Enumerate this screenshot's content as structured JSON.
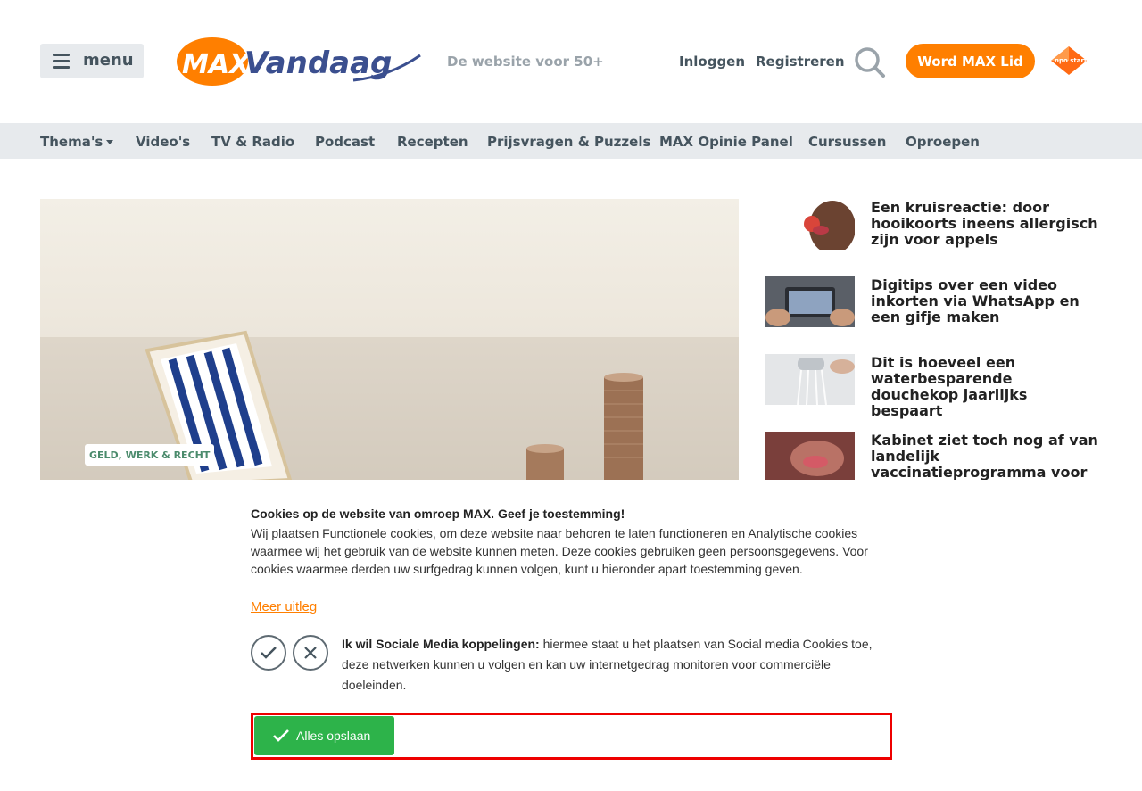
{
  "header": {
    "menu_label": "menu",
    "tagline": "De website voor 50+",
    "login": "Inloggen",
    "register": "Registreren",
    "member_button": "Word MAX Lid",
    "npo_label": "npo start"
  },
  "nav": {
    "items": [
      "Thema's",
      "Video's",
      "TV & Radio",
      "Podcast",
      "Recepten",
      "Prijsvragen & Puzzels",
      "MAX Opinie Panel",
      "Cursussen",
      "Oproepen"
    ]
  },
  "hero": {
    "badge": "GELD, WERK & RECHT"
  },
  "sidebar": {
    "items": [
      {
        "title": "Een kruisreactie: door hooikoorts ineens allergisch zijn voor appels"
      },
      {
        "title": "Digitips over een video inkorten via WhatsApp en een gifje maken"
      },
      {
        "title": "Dit is hoeveel een waterbesparende douchekop jaarlijks bespaart"
      },
      {
        "title": "Kabinet ziet toch nog af van landelijk vaccinatieprogramma voor"
      }
    ]
  },
  "cookie": {
    "title": "Cookies op de website van omroep MAX. Geef je toestemming!",
    "text": "Wij plaatsen Functionele cookies, om deze website naar behoren te laten functioneren en Analytische cookies waarmee wij het gebruik van de website kunnen meten. Deze cookies gebruiken geen persoonsgegevens. Voor cookies waarmee derden uw surfgedrag kunnen volgen, kunt u hieronder apart toestemming geven.",
    "more_link": "Meer uitleg",
    "social_bold": "Ik wil Sociale Media koppelingen:",
    "social_text": " hiermee staat u het plaatsen van Social media Cookies toe, deze netwerken kunnen u volgen en kan uw internetgedrag monitoren voor commerciële doeleinden.",
    "save_button": "Alles opslaan"
  },
  "colors": {
    "brand_orange": "#ff7f00",
    "brand_blue": "#3b4f8f",
    "nav_bg": "#e7eaed",
    "save_green": "#2db34a",
    "highlight_red": "#ee0000"
  }
}
